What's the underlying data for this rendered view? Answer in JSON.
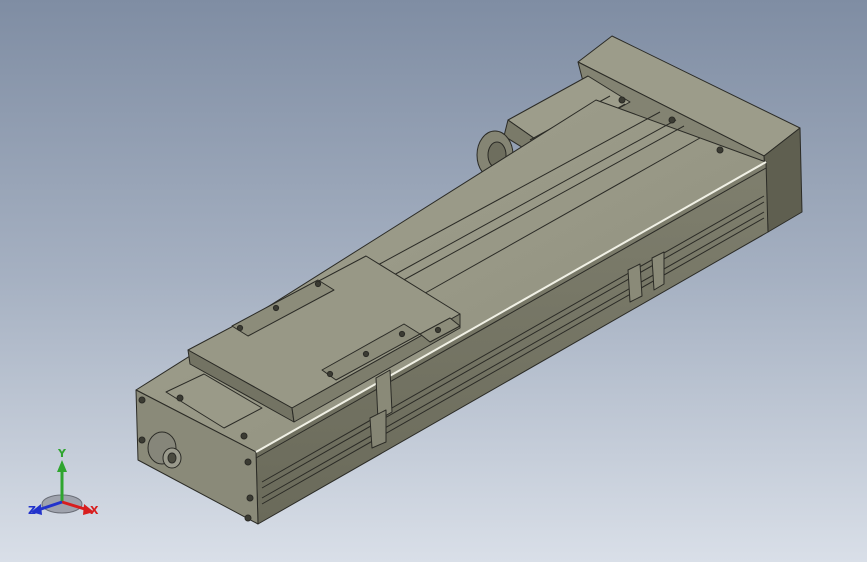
{
  "viewport": {
    "background_top": "#7f8da3",
    "background_bottom": "#d9dfe8"
  },
  "model": {
    "description_icon": "linear-actuator-3d-model",
    "body_color": "#8e8e7c",
    "edge_color": "#2b2b26"
  },
  "triad": {
    "x_label": "X",
    "y_label": "Y",
    "z_label": "Z",
    "x_color": "#d81e1e",
    "y_color": "#2fa52f",
    "z_color": "#2233cc"
  }
}
